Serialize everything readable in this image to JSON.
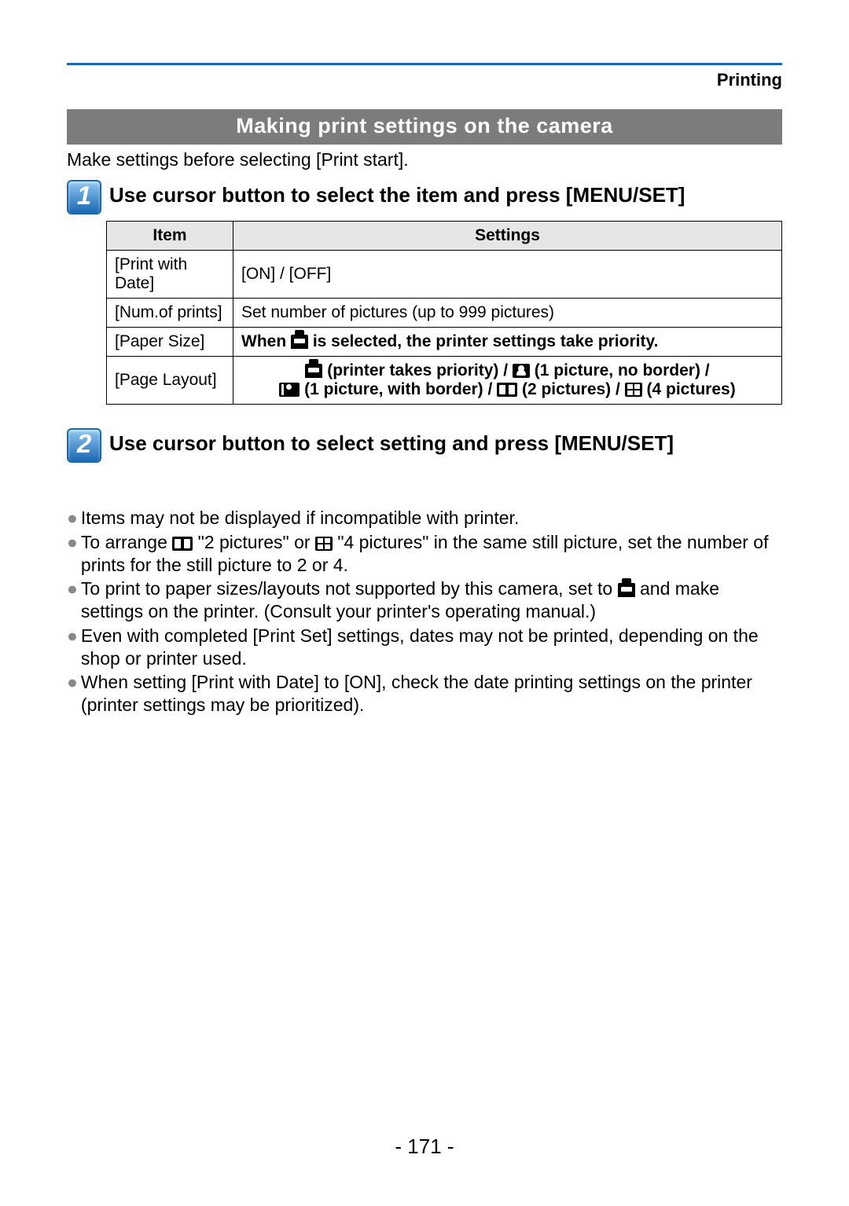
{
  "chapter": "Printing",
  "band": "Making print settings on the camera",
  "intro": "Make settings before selecting [Print start].",
  "step1": {
    "num": "1",
    "title": "Use cursor button to select the item and press [MENU/SET]",
    "th_item": "Item",
    "th_settings": "Settings",
    "r1_item": "[Print with Date]",
    "r1_set": "[ON] / [OFF]",
    "r2_item": "[Num.of prints]",
    "r2_set": "Set number of pictures (up to 999 pictures)",
    "r3_item": "[Paper Size]",
    "r3_a": "When ",
    "r3_b": " is selected, the printer settings take priority.",
    "r4_item": "[Page Layout]",
    "r4_a": " (printer takes priority) / ",
    "r4_b": " (1 picture, no border) /",
    "r4_c": " (1 picture, with border) / ",
    "r4_d": " (2 pictures) / ",
    "r4_e": " (4 pictures)"
  },
  "step2": {
    "num": "2",
    "title": "Use cursor button to select setting and press [MENU/SET]"
  },
  "bul": {
    "b1": "Items may not be displayed if incompatible with printer.",
    "b2a": "To arrange ",
    "b2b": " \"2 pictures\" or ",
    "b2c": " \"4 pictures\" in the same still picture, set the number of prints for the still picture to 2 or 4.",
    "b3a": "To print to paper sizes/layouts not supported by this camera, set to ",
    "b3b": " and make settings on the printer. (Consult your printer's operating manual.)",
    "b4": "Even with completed [Print Set] settings, dates may not be printed, depending on the shop or printer used.",
    "b5": "When setting [Print with Date] to [ON], check the date printing settings on the printer (printer settings may be prioritized)."
  },
  "page_number": "- 171 -"
}
